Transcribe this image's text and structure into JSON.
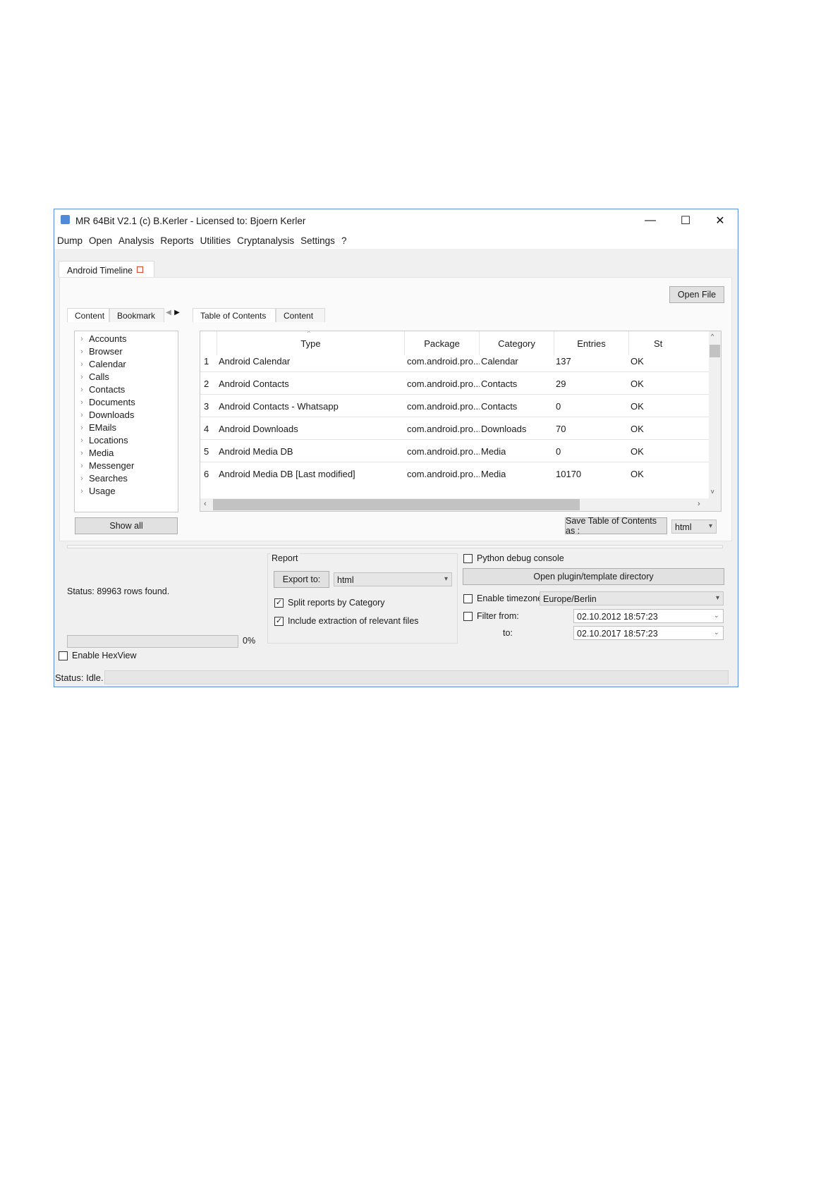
{
  "window": {
    "title": "MR 64Bit V2.1 (c) B.Kerler - Licensed to: Bjoern Kerler",
    "minimize": "—",
    "maximize": "☐",
    "close": "✕"
  },
  "menu": [
    "Dump",
    "Open",
    "Analysis",
    "Reports",
    "Utilities",
    "Cryptanalysis",
    "Settings",
    "?"
  ],
  "main_tab": {
    "label": "Android Timeline"
  },
  "open_file_label": "Open File",
  "left_tabs": {
    "content": "Content",
    "bookmark": "Bookmark"
  },
  "tree_items": [
    "Accounts",
    "Browser",
    "Calendar",
    "Calls",
    "Contacts",
    "Documents",
    "Downloads",
    "EMails",
    "Locations",
    "Media",
    "Messenger",
    "Searches",
    "Usage"
  ],
  "show_all_label": "Show all",
  "right_tabs": {
    "toc": "Table of Contents",
    "content": "Content"
  },
  "table": {
    "columns": [
      "Type",
      "Package",
      "Category",
      "Entries",
      "St"
    ],
    "rows": [
      {
        "n": "1",
        "type": "Android Calendar",
        "package": "com.android.pro...",
        "category": "Calendar",
        "entries": "137",
        "status": "OK"
      },
      {
        "n": "2",
        "type": "Android Contacts",
        "package": "com.android.pro...",
        "category": "Contacts",
        "entries": "29",
        "status": "OK"
      },
      {
        "n": "3",
        "type": "Android Contacts - Whatsapp",
        "package": "com.android.pro...",
        "category": "Contacts",
        "entries": "0",
        "status": "OK"
      },
      {
        "n": "4",
        "type": "Android Downloads",
        "package": "com.android.pro...",
        "category": "Downloads",
        "entries": "70",
        "status": "OK"
      },
      {
        "n": "5",
        "type": "Android Media DB",
        "package": "com.android.pro...",
        "category": "Media",
        "entries": "0",
        "status": "OK"
      },
      {
        "n": "6",
        "type": "Android Media DB [Last modified]",
        "package": "com.android.pro...",
        "category": "Media",
        "entries": "10170",
        "status": "OK"
      }
    ]
  },
  "save_toc": {
    "label": "Save Table of Contents as :",
    "format": "html"
  },
  "status_rows": "Status: 89963 rows found.",
  "progress": {
    "value": 0,
    "label": "0%"
  },
  "report": {
    "title": "Report",
    "export_label": "Export to:",
    "export_format": "html",
    "split_label": "Split reports by Category",
    "split_checked": true,
    "include_label": "Include extraction of relevant files",
    "include_checked": true
  },
  "options": {
    "python_debug": "Python debug console",
    "open_plugin": "Open plugin/template directory",
    "enable_timezone": "Enable timezone",
    "timezone": "Europe/Berlin",
    "filter_from": "Filter from:",
    "from_value": "02.10.2012 18:57:23",
    "to_label": "to:",
    "to_value": "02.10.2017 18:57:23"
  },
  "hexview_label": "Enable HexView",
  "status_idle": "Status: Idle."
}
